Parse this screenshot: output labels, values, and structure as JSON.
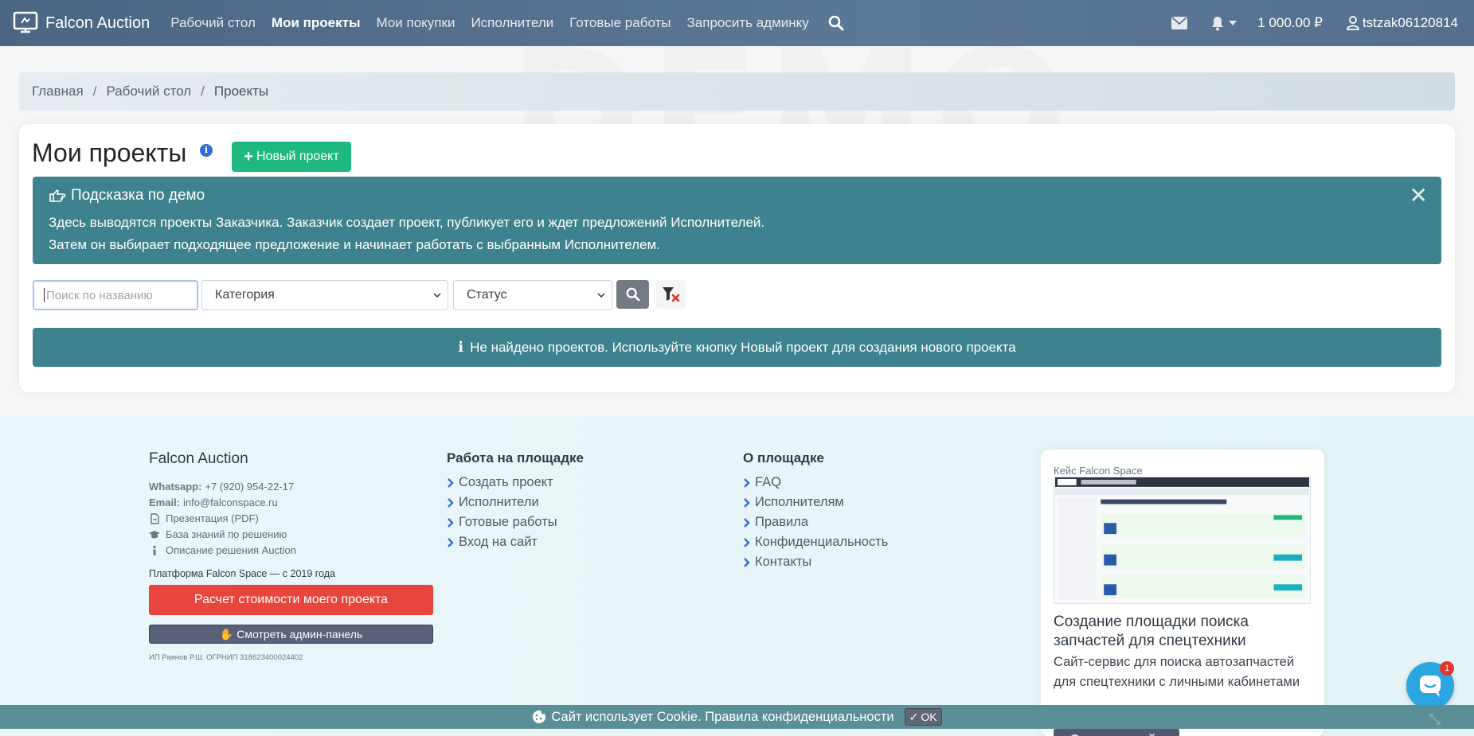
{
  "navbar": {
    "brand": "Falcon Auction",
    "items": [
      "Рабочий стол",
      "Мои проекты",
      "Мои покупки",
      "Исполнители",
      "Готовые работы",
      "Запросить админку"
    ],
    "active_index": 1,
    "balance": "1 000.00 ₽",
    "username": "tstzak06120814"
  },
  "breadcrumb": {
    "items": [
      "Главная",
      "Рабочий стол",
      "Проекты"
    ]
  },
  "main": {
    "title": "Мои проекты",
    "new_button": "Новый проект",
    "alert": {
      "title": "Подсказка по демо",
      "line1": "Здесь выводятся проекты Заказчика. Заказчик создает проект, публикует его и ждет предложений Исполнителей.",
      "line2": "Затем он выбирает подходящее предложение и начинает работать с выбранным Исполнителем."
    },
    "filters": {
      "search_placeholder": "Поиск по названию",
      "category": "Категория",
      "status": "Статус"
    },
    "empty_message": "Не найдено проектов. Используйте кнопку Новый проект для создания нового проекта"
  },
  "footer": {
    "col1": {
      "title": "Falcon Auction",
      "whatsapp_label": "Whatsapp:",
      "whatsapp": "+7 (920) 954-22-17",
      "email_label": "Email:",
      "email": "info@falconspace.ru",
      "links": [
        "Презентация (PDF)",
        "База знаний по решению",
        "Описание решения Auction"
      ],
      "platform_prefix": "Платформа Falcon Space",
      "platform_suffix": " — с 2019 года",
      "calc_button": "Расчет стоимости моего проекта",
      "admin_button": "Смотреть админ-панель",
      "legal": "ИП Раянов Р.Ш. ОГРНИП 318623400024402"
    },
    "col2": {
      "title": "Работа на площадке",
      "links": [
        "Создать проект",
        "Исполнители",
        "Готовые работы",
        "Вход на сайт"
      ]
    },
    "col3": {
      "title": "О площадке",
      "links": [
        "FAQ",
        "Исполнителям",
        "Правила",
        "Конфиденциальность",
        "Контакты"
      ]
    },
    "case": {
      "label": "Кейс Falcon Space",
      "title": "Создание площадки поиска запчастей для спецтехники",
      "description": "Сайт-сервис для поиска автозапчастей для спецтехники с личными кабинетами",
      "button": "Смотреть кейс"
    }
  },
  "chat": {
    "badge": "1"
  },
  "cookie": {
    "text": "Сайт использует Cookie. Правила конфиденциальности",
    "ok": "OK"
  },
  "colors": {
    "navbar": "#55718f",
    "alert": "#3d828e",
    "new_button": "#1fb980",
    "calc_button": "#e8453c"
  }
}
